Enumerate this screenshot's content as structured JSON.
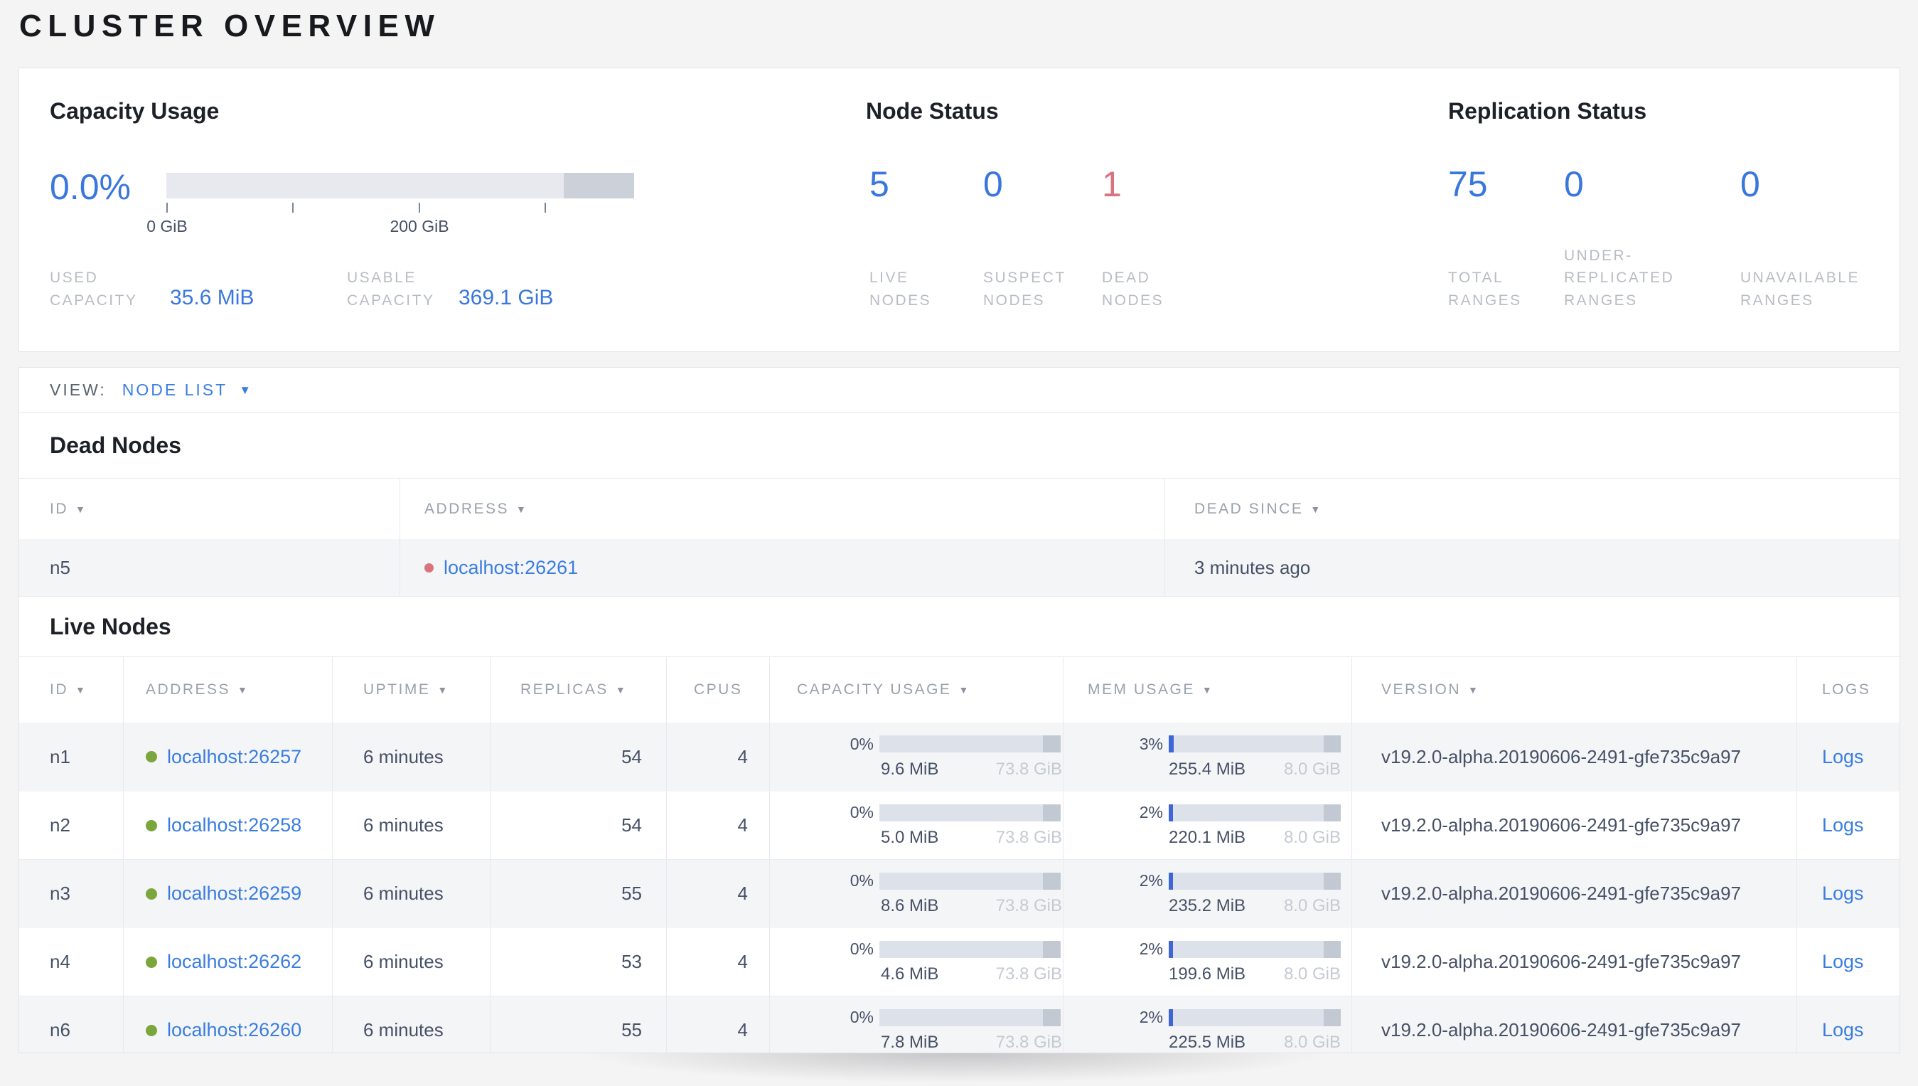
{
  "page": {
    "title": "CLUSTER OVERVIEW"
  },
  "colors": {
    "accent_blue": "#3a77dd",
    "link_blue": "#3a7de1",
    "dead_red": "#d9737f",
    "live_green": "#7ba63c",
    "bar_track": "#dde1ea",
    "bar_other": "#c3c9d3",
    "bar_fill": "#3e66d6"
  },
  "icons": {
    "sort_desc": "▼",
    "dropdown_caret": "▼"
  },
  "capacity": {
    "title": "Capacity Usage",
    "percent": "0.0%",
    "bar": {
      "used_pct": 0,
      "other_start_pct": 85
    },
    "axis_ticks": [
      "0 GiB",
      "",
      "200 GiB",
      ""
    ],
    "used_label_line1": "USED",
    "used_label_line2": "CAPACITY",
    "used_value": "35.6 MiB",
    "usable_label_line1": "USABLE",
    "usable_label_line2": "CAPACITY",
    "usable_value": "369.1 GiB"
  },
  "node_status": {
    "title": "Node Status",
    "stats": [
      {
        "value": "5",
        "lines": [
          "LIVE",
          "NODES"
        ]
      },
      {
        "value": "0",
        "lines": [
          "SUSPECT",
          "NODES"
        ]
      },
      {
        "value": "1",
        "lines": [
          "DEAD",
          "NODES"
        ]
      }
    ]
  },
  "replication": {
    "title": "Replication Status",
    "stats": [
      {
        "value": "75",
        "lines": [
          "TOTAL",
          "RANGES"
        ]
      },
      {
        "value": "0",
        "lines": [
          "UNDER-",
          "REPLICATED",
          "RANGES"
        ]
      },
      {
        "value": "0",
        "lines": [
          "UNAVAILABLE",
          "RANGES"
        ]
      }
    ]
  },
  "view_bar": {
    "label": "VIEW:",
    "value": "NODE LIST"
  },
  "dead_nodes": {
    "title": "Dead Nodes",
    "columns": [
      {
        "label": "ID"
      },
      {
        "label": "ADDRESS"
      },
      {
        "label": "DEAD SINCE"
      }
    ],
    "rows": [
      {
        "id": "n5",
        "address": "localhost:26261",
        "dead_since": "3 minutes ago"
      }
    ]
  },
  "live_nodes": {
    "title": "Live Nodes",
    "columns": [
      {
        "label": "ID"
      },
      {
        "label": "ADDRESS"
      },
      {
        "label": "UPTIME"
      },
      {
        "label": "REPLICAS"
      },
      {
        "label": "CPUS"
      },
      {
        "label": "CAPACITY USAGE"
      },
      {
        "label": "MEM USAGE"
      },
      {
        "label": "VERSION"
      },
      {
        "label": "LOGS"
      }
    ],
    "rows": [
      {
        "id": "n1",
        "address": "localhost:26257",
        "uptime": "6 minutes",
        "replicas": "54",
        "cpus": "4",
        "capacity": {
          "percent": "0%",
          "used": "9.6 MiB",
          "total": "73.8 GiB",
          "fill_pct": 0
        },
        "mem": {
          "percent": "3%",
          "used": "255.4 MiB",
          "total": "8.0 GiB",
          "fill_pct": 3
        },
        "version": "v19.2.0-alpha.20190606-2491-gfe735c9a97",
        "logs": "Logs"
      },
      {
        "id": "n2",
        "address": "localhost:26258",
        "uptime": "6 minutes",
        "replicas": "54",
        "cpus": "4",
        "capacity": {
          "percent": "0%",
          "used": "5.0 MiB",
          "total": "73.8 GiB",
          "fill_pct": 0
        },
        "mem": {
          "percent": "2%",
          "used": "220.1 MiB",
          "total": "8.0 GiB",
          "fill_pct": 2.5
        },
        "version": "v19.2.0-alpha.20190606-2491-gfe735c9a97",
        "logs": "Logs"
      },
      {
        "id": "n3",
        "address": "localhost:26259",
        "uptime": "6 minutes",
        "replicas": "55",
        "cpus": "4",
        "capacity": {
          "percent": "0%",
          "used": "8.6 MiB",
          "total": "73.8 GiB",
          "fill_pct": 0
        },
        "mem": {
          "percent": "2%",
          "used": "235.2 MiB",
          "total": "8.0 GiB",
          "fill_pct": 2.5
        },
        "version": "v19.2.0-alpha.20190606-2491-gfe735c9a97",
        "logs": "Logs"
      },
      {
        "id": "n4",
        "address": "localhost:26262",
        "uptime": "6 minutes",
        "replicas": "53",
        "cpus": "4",
        "capacity": {
          "percent": "0%",
          "used": "4.6 MiB",
          "total": "73.8 GiB",
          "fill_pct": 0
        },
        "mem": {
          "percent": "2%",
          "used": "199.6 MiB",
          "total": "8.0 GiB",
          "fill_pct": 2.5
        },
        "version": "v19.2.0-alpha.20190606-2491-gfe735c9a97",
        "logs": "Logs"
      },
      {
        "id": "n6",
        "address": "localhost:26260",
        "uptime": "6 minutes",
        "replicas": "55",
        "cpus": "4",
        "capacity": {
          "percent": "0%",
          "used": "7.8 MiB",
          "total": "73.8 GiB",
          "fill_pct": 0
        },
        "mem": {
          "percent": "2%",
          "used": "225.5 MiB",
          "total": "8.0 GiB",
          "fill_pct": 2.5
        },
        "version": "v19.2.0-alpha.20190606-2491-gfe735c9a97",
        "logs": "Logs"
      }
    ]
  }
}
